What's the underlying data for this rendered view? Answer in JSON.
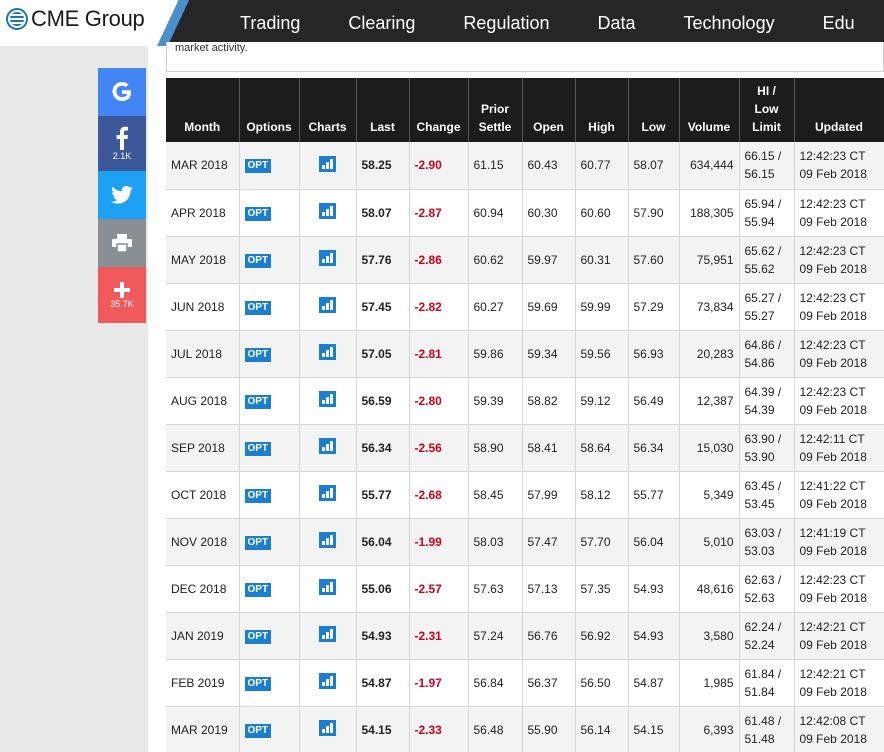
{
  "brand": {
    "logo_text": "CME Group"
  },
  "nav": [
    "Trading",
    "Clearing",
    "Regulation",
    "Data",
    "Technology",
    "Edu"
  ],
  "share": {
    "facebook_count": "2.1K",
    "plus_count": "35.7K"
  },
  "note": "market activity.",
  "table": {
    "headers": {
      "month": "Month",
      "options": "Options",
      "charts": "Charts",
      "last": "Last",
      "change": "Change",
      "prior_settle_1": "Prior",
      "prior_settle_2": "Settle",
      "open": "Open",
      "high": "High",
      "low": "Low",
      "volume": "Volume",
      "hilo_1": "HI /",
      "hilo_2": "Low",
      "hilo_3": "Limit",
      "updated": "Updated"
    },
    "opt_label": "OPT",
    "rows": [
      {
        "month": "MAR 2018",
        "last": "58.25",
        "change": "-2.90",
        "prior": "61.15",
        "open": "60.43",
        "high": "60.77",
        "low": "58.07",
        "volume": "634,444",
        "hi": "66.15 /",
        "lo": "56.15",
        "time": "12:42:23 CT",
        "date": "09 Feb 2018"
      },
      {
        "month": "APR 2018",
        "last": "58.07",
        "change": "-2.87",
        "prior": "60.94",
        "open": "60.30",
        "high": "60.60",
        "low": "57.90",
        "volume": "188,305",
        "hi": "65.94 /",
        "lo": "55.94",
        "time": "12:42:23 CT",
        "date": "09 Feb 2018"
      },
      {
        "month": "MAY 2018",
        "last": "57.76",
        "change": "-2.86",
        "prior": "60.62",
        "open": "59.97",
        "high": "60.31",
        "low": "57.60",
        "volume": "75,951",
        "hi": "65.62 /",
        "lo": "55.62",
        "time": "12:42:23 CT",
        "date": "09 Feb 2018"
      },
      {
        "month": "JUN 2018",
        "last": "57.45",
        "change": "-2.82",
        "prior": "60.27",
        "open": "59.69",
        "high": "59.99",
        "low": "57.29",
        "volume": "73,834",
        "hi": "65.27 /",
        "lo": "55.27",
        "time": "12:42:23 CT",
        "date": "09 Feb 2018"
      },
      {
        "month": "JUL 2018",
        "last": "57.05",
        "change": "-2.81",
        "prior": "59.86",
        "open": "59.34",
        "high": "59.56",
        "low": "56.93",
        "volume": "20,283",
        "hi": "64.86 /",
        "lo": "54.86",
        "time": "12:42:23 CT",
        "date": "09 Feb 2018"
      },
      {
        "month": "AUG 2018",
        "last": "56.59",
        "change": "-2.80",
        "prior": "59.39",
        "open": "58.82",
        "high": "59.12",
        "low": "56.49",
        "volume": "12,387",
        "hi": "64.39 /",
        "lo": "54.39",
        "time": "12:42:23 CT",
        "date": "09 Feb 2018"
      },
      {
        "month": "SEP 2018",
        "last": "56.34",
        "change": "-2.56",
        "prior": "58.90",
        "open": "58.41",
        "high": "58.64",
        "low": "56.34",
        "volume": "15,030",
        "hi": "63.90 /",
        "lo": "53.90",
        "time": "12:42:11 CT",
        "date": "09 Feb 2018"
      },
      {
        "month": "OCT 2018",
        "last": "55.77",
        "change": "-2.68",
        "prior": "58.45",
        "open": "57.99",
        "high": "58.12",
        "low": "55.77",
        "volume": "5,349",
        "hi": "63.45 /",
        "lo": "53.45",
        "time": "12:41:22 CT",
        "date": "09 Feb 2018"
      },
      {
        "month": "NOV 2018",
        "last": "56.04",
        "change": "-1.99",
        "prior": "58.03",
        "open": "57.47",
        "high": "57.70",
        "low": "56.04",
        "volume": "5,010",
        "hi": "63.03 /",
        "lo": "53.03",
        "time": "12:41:19 CT",
        "date": "09 Feb 2018"
      },
      {
        "month": "DEC 2018",
        "last": "55.06",
        "change": "-2.57",
        "prior": "57.63",
        "open": "57.13",
        "high": "57.35",
        "low": "54.93",
        "volume": "48,616",
        "hi": "62.63 /",
        "lo": "52.63",
        "time": "12:42:23 CT",
        "date": "09 Feb 2018"
      },
      {
        "month": "JAN 2019",
        "last": "54.93",
        "change": "-2.31",
        "prior": "57.24",
        "open": "56.76",
        "high": "56.92",
        "low": "54.93",
        "volume": "3,580",
        "hi": "62.24 /",
        "lo": "52.24",
        "time": "12:42:21 CT",
        "date": "09 Feb 2018"
      },
      {
        "month": "FEB 2019",
        "last": "54.87",
        "change": "-1.97",
        "prior": "56.84",
        "open": "56.37",
        "high": "56.50",
        "low": "54.87",
        "volume": "1,985",
        "hi": "61.84 /",
        "lo": "51.84",
        "time": "12:42:21 CT",
        "date": "09 Feb 2018"
      },
      {
        "month": "MAR 2019",
        "last": "54.15",
        "change": "-2.33",
        "prior": "56.48",
        "open": "55.90",
        "high": "56.14",
        "low": "54.15",
        "volume": "6,393",
        "hi": "61.48 /",
        "lo": "51.48",
        "time": "12:42:08 CT",
        "date": "09 Feb 2018"
      }
    ]
  }
}
